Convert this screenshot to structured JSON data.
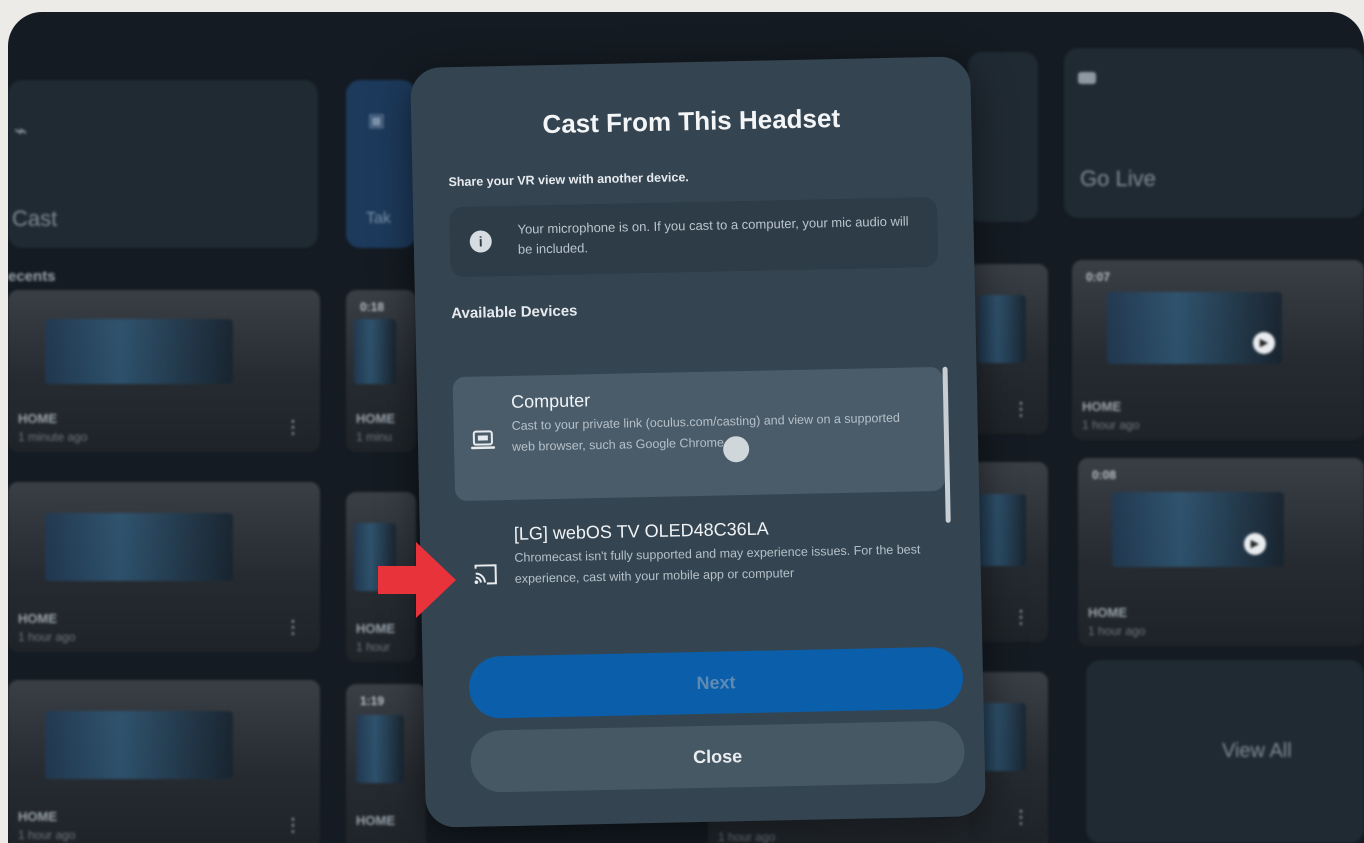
{
  "background": {
    "cast_tile_label": "Cast",
    "go_live_label": "Go Live",
    "recents_label": "ecents",
    "view_all_label": "View All",
    "partial_tile_label": "Tak",
    "videos": [
      {
        "label": "HOME",
        "time": "1 minute ago",
        "duration": ""
      },
      {
        "label": "HOME",
        "time": "1 minu",
        "duration": "0:18"
      },
      {
        "label": "HOME",
        "time": "1 hour ago",
        "duration": "0:07"
      },
      {
        "label": "HOME",
        "time": "1 hour ago",
        "duration": ""
      },
      {
        "label": "HOME",
        "time": "1 hour",
        "duration": ""
      },
      {
        "label": "HOME",
        "time": "1 hour ago",
        "duration": "0:08"
      },
      {
        "label": "HOME",
        "time": "1 hour ago",
        "duration": ""
      },
      {
        "label": "HOME",
        "time": "1 hour ago",
        "duration": "1:19"
      },
      {
        "label": "",
        "time": "1 hour ago",
        "duration": ""
      }
    ]
  },
  "modal": {
    "title": "Cast From This Headset",
    "subtitle": "Share your VR view with another device.",
    "notice_text": "Your microphone is on. If you cast to a computer, your mic audio will be included.",
    "section_title": "Available Devices",
    "devices": [
      {
        "name": "Computer",
        "description": "Cast to your private link (oculus.com/casting) and view on a supported web browser, such as Google Chrome.",
        "icon": "laptop-icon",
        "selected": true
      },
      {
        "name": "[LG] webOS TV OLED48C36LA",
        "description": "Chromecast isn't fully supported and may experience issues. For the best experience, cast with your mobile app or computer",
        "icon": "cast-icon",
        "selected": false
      }
    ],
    "next_label": "Next",
    "close_label": "Close"
  },
  "colors": {
    "modal_bg": "#344551",
    "next_button": "#0b5ea9",
    "close_button": "#475865",
    "arrow": "#e8333b"
  }
}
